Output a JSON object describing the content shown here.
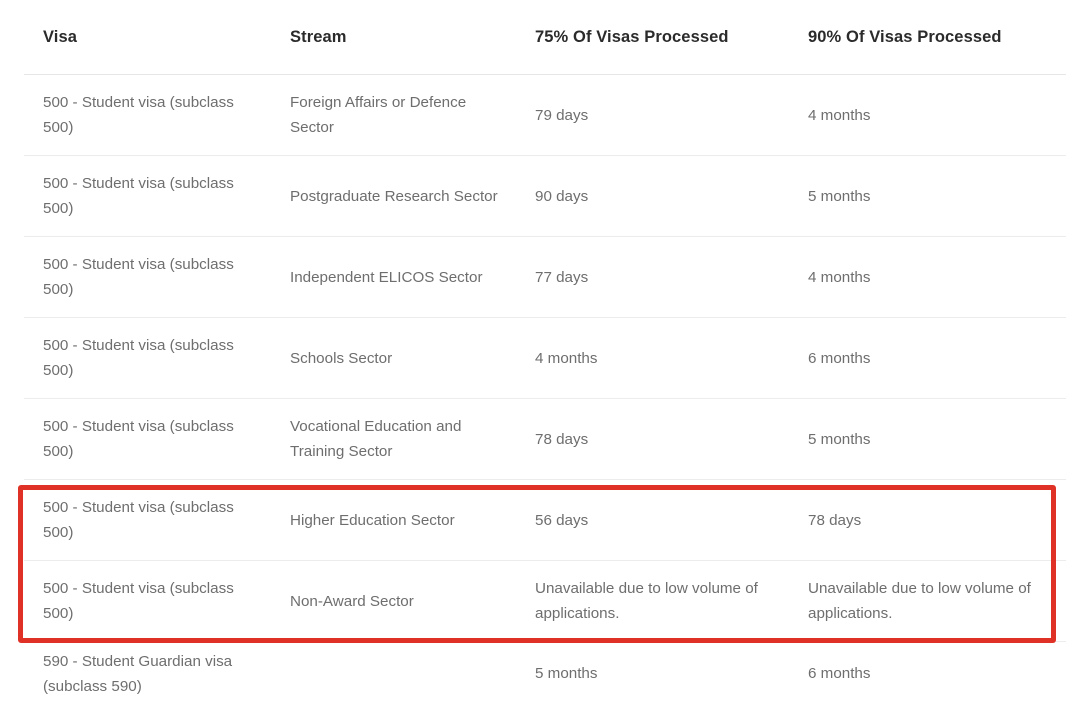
{
  "table": {
    "name": "visa-processing-times",
    "columns": [
      {
        "key": "visa",
        "label": "Visa"
      },
      {
        "key": "stream",
        "label": "Stream"
      },
      {
        "key": "p75",
        "label": "75% Of Visas Processed"
      },
      {
        "key": "p90",
        "label": "90% Of Visas Processed"
      }
    ],
    "rows": [
      {
        "visa": "500 - Student visa (subclass 500)",
        "stream": "Foreign Affairs or Defence Sector",
        "p75": "79 days",
        "p90": "4 months",
        "highlighted": false
      },
      {
        "visa": "500 - Student visa (subclass 500)",
        "stream": "Postgraduate Research Sector",
        "p75": "90 days",
        "p90": "5 months",
        "highlighted": false
      },
      {
        "visa": "500 - Student visa (subclass 500)",
        "stream": "Independent ELICOS Sector",
        "p75": "77 days",
        "p90": "4 months",
        "highlighted": false
      },
      {
        "visa": "500 - Student visa (subclass 500)",
        "stream": "Schools Sector",
        "p75": "4 months",
        "p90": "6 months",
        "highlighted": false
      },
      {
        "visa": "500 - Student visa (subclass 500)",
        "stream": "Vocational Education and Training Sector",
        "p75": "78 days",
        "p90": "5 months",
        "highlighted": false
      },
      {
        "visa": "500 - Student visa (subclass 500)",
        "stream": "Higher Education Sector",
        "p75": "56 days",
        "p90": "78 days",
        "highlighted": true
      },
      {
        "visa": "500 - Student visa (subclass 500)",
        "stream": "Non-Award Sector",
        "p75": "Unavailable due to low volume of applications.",
        "p90": "Unavailable due to low volume of applications.",
        "highlighted": true
      },
      {
        "visa": "590 - Student Guardian visa (subclass 590)",
        "stream": "",
        "p75": "5 months",
        "p90": "6 months",
        "highlighted": false
      }
    ]
  },
  "annotation": {
    "type": "rectangle-highlight",
    "color": "#e03127",
    "covers_rows": [
      6,
      7
    ]
  },
  "colors": {
    "header_text": "#2b2b2b",
    "body_text": "#6e6e6e",
    "row_divider": "#ececec",
    "header_divider": "#e6e6e6",
    "highlight": "#e03127",
    "background": "#ffffff"
  }
}
